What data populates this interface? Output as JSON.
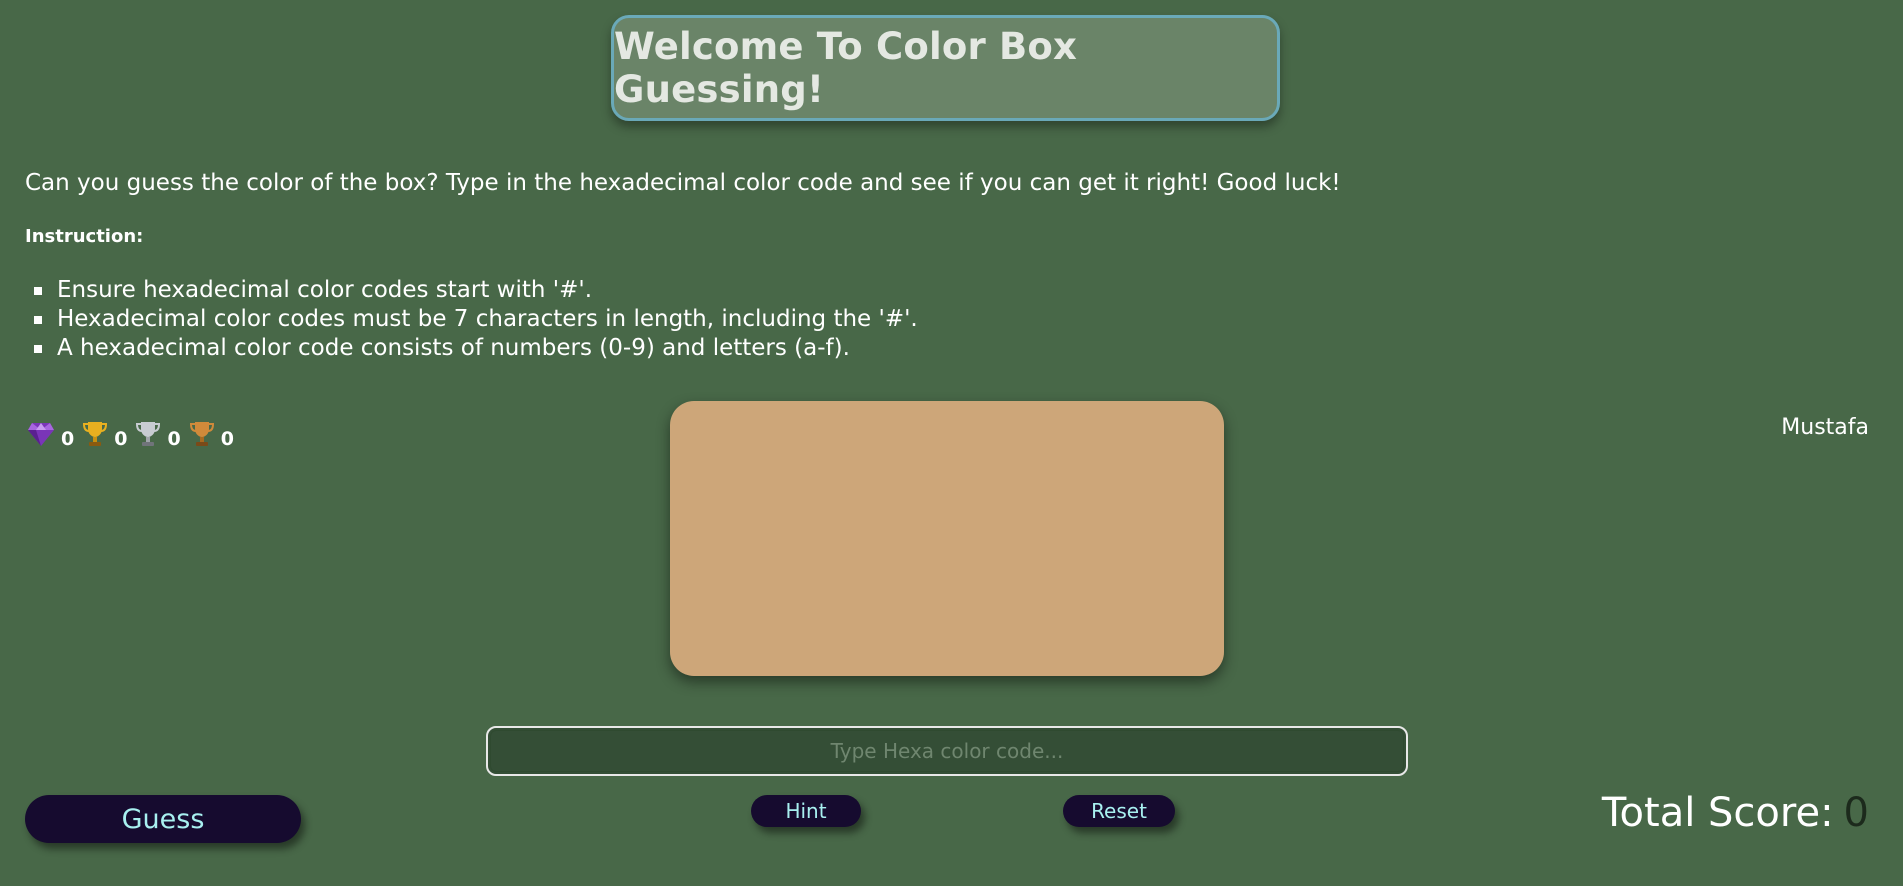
{
  "header": {
    "title": "Welcome To Color Box Guessing!"
  },
  "intro": "Can you guess the color of the box? Type in the hexadecimal color code and see if you can get it right! Good luck!",
  "instructions": {
    "heading": "Instruction:",
    "items": [
      "Ensure hexadecimal color codes start with '#'.",
      "Hexadecimal color codes must be 7 characters in length, including the '#'.",
      "A hexadecimal color code consists of numbers (0-9) and letters (a-f)."
    ]
  },
  "trophies": [
    {
      "icon": "gem-icon",
      "color": "#8a3fc8",
      "count": "0"
    },
    {
      "icon": "gold-trophy-icon",
      "color": "#e8b020",
      "count": "0"
    },
    {
      "icon": "silver-trophy-icon",
      "color": "#c8ccd2",
      "count": "0"
    },
    {
      "icon": "bronze-trophy-icon",
      "color": "#d08a3a",
      "count": "0"
    }
  ],
  "user": {
    "name": "Mustafa"
  },
  "box": {
    "color": "#cda679"
  },
  "input": {
    "placeholder": "Type Hexa color code...",
    "value": ""
  },
  "buttons": {
    "guess": "Guess",
    "hint": "Hint",
    "reset": "Reset"
  },
  "score": {
    "label": "Total Score:",
    "value": "0"
  },
  "colors": {
    "background": "#486848",
    "title_box": "#6a8468",
    "title_border": "#6aa9b8",
    "button_bg": "#160b2f",
    "button_text": "#a8f0f0"
  }
}
